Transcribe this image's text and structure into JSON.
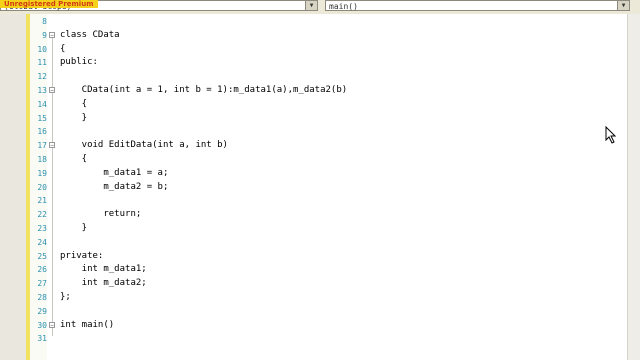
{
  "window": {
    "tab_label": "Unregistered Premium",
    "left_dropdown": "(Global Scope)",
    "right_dropdown": "main()"
  },
  "code_lines": [
    {
      "n": "8",
      "text": ""
    },
    {
      "n": "9",
      "text": "class CData",
      "kw": [
        "class"
      ]
    },
    {
      "n": "10",
      "text": "{"
    },
    {
      "n": "11",
      "text": "public:",
      "kw": [
        "public"
      ]
    },
    {
      "n": "12",
      "text": ""
    },
    {
      "n": "13",
      "text": "    CData(int a = 1, int b = 1):m_data1(a),m_data2(b)",
      "kw": [
        "int"
      ]
    },
    {
      "n": "14",
      "text": "    {"
    },
    {
      "n": "15",
      "text": "    }"
    },
    {
      "n": "16",
      "text": ""
    },
    {
      "n": "17",
      "text": "    void EditData(int a, int b)",
      "kw": [
        "void",
        "int"
      ]
    },
    {
      "n": "18",
      "text": "    {"
    },
    {
      "n": "19",
      "text": "        m_data1 = a;"
    },
    {
      "n": "20",
      "text": "        m_data2 = b;"
    },
    {
      "n": "21",
      "text": ""
    },
    {
      "n": "22",
      "text": "        return;",
      "kw": [
        "return"
      ]
    },
    {
      "n": "23",
      "text": "    }"
    },
    {
      "n": "24",
      "text": ""
    },
    {
      "n": "25",
      "text": "private:",
      "kw": [
        "private"
      ]
    },
    {
      "n": "26",
      "text": "    int m_data1;",
      "kw": [
        "int"
      ]
    },
    {
      "n": "27",
      "text": "    int m_data2;",
      "kw": [
        "int"
      ]
    },
    {
      "n": "28",
      "text": "};"
    },
    {
      "n": "29",
      "text": ""
    },
    {
      "n": "30",
      "text": "int main()",
      "kw": [
        "int"
      ]
    },
    {
      "n": "31",
      "text": ""
    }
  ]
}
